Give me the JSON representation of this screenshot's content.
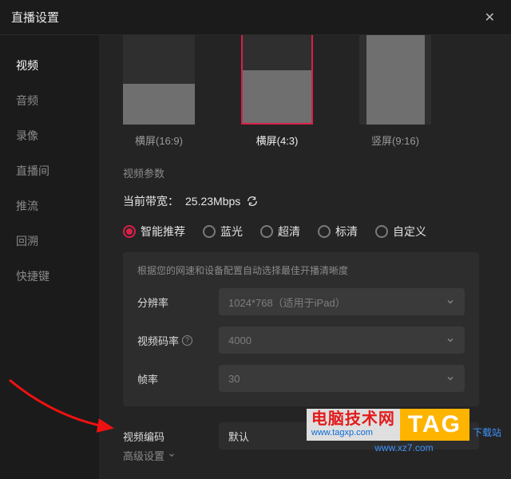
{
  "titlebar": {
    "title": "直播设置"
  },
  "sidebar": {
    "items": [
      {
        "label": "视频",
        "active": true
      },
      {
        "label": "音频"
      },
      {
        "label": "录像"
      },
      {
        "label": "直播间"
      },
      {
        "label": "推流"
      },
      {
        "label": "回溯"
      },
      {
        "label": "快捷键"
      }
    ]
  },
  "thumbs": {
    "items": [
      {
        "label": "横屏(16:9)",
        "kind": "169"
      },
      {
        "label": "横屏(4:3)",
        "kind": "43",
        "active": true
      },
      {
        "label": "竖屏(9:16)",
        "kind": "916"
      }
    ]
  },
  "section_video_params": "视频参数",
  "bandwidth": {
    "label": "当前带宽：",
    "value": "25.23Mbps"
  },
  "quality": {
    "options": [
      {
        "label": "智能推荐",
        "selected": true
      },
      {
        "label": "蓝光"
      },
      {
        "label": "超清"
      },
      {
        "label": "标清"
      },
      {
        "label": "自定义"
      }
    ]
  },
  "rec": {
    "note": "根据您的网速和设备配置自动选择最佳开播清晰度",
    "resolution_label": "分辨率",
    "resolution_value": "1024*768（适用于iPad）",
    "bitrate_label": "视频码率",
    "bitrate_value": "4000",
    "fps_label": "帧率",
    "fps_value": "30"
  },
  "encode": {
    "label": "视频编码",
    "value": "默认"
  },
  "advanced": {
    "label": "高级设置"
  },
  "watermark": {
    "cn": "电脑技术网",
    "url": "www.tagxp.com",
    "tag": "TAG",
    "side": "下载站",
    "sub": "www.xz7.com"
  }
}
